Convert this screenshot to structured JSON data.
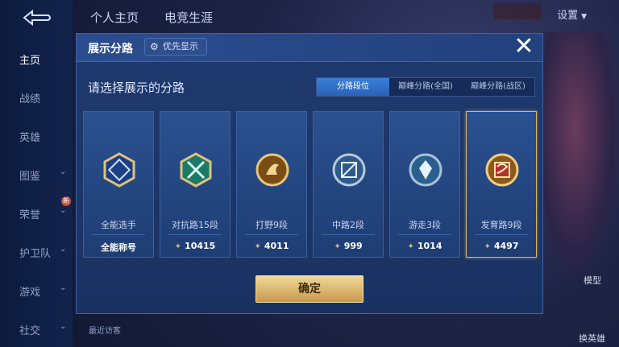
{
  "sidebar": {
    "items": [
      {
        "label": "主页"
      },
      {
        "label": "战绩"
      },
      {
        "label": "英雄"
      },
      {
        "label": "图鉴"
      },
      {
        "label": "荣誉"
      },
      {
        "label": "护卫队"
      },
      {
        "label": "游戏"
      },
      {
        "label": "社交"
      }
    ],
    "badge": "新"
  },
  "topbar": {
    "tabs": [
      {
        "label": "个人主页"
      },
      {
        "label": "电竞生涯"
      }
    ],
    "settings": "设置"
  },
  "background": {
    "recent": "最近访客",
    "model": "模型",
    "hero": "换英雄"
  },
  "modal": {
    "title": "展示分路",
    "priority_button": "优先显示",
    "prompt": "请选择展示的分路",
    "tabs": [
      {
        "label": "分路段位",
        "active": true
      },
      {
        "label": "巅峰分路(全国)",
        "active": false
      },
      {
        "label": "巅峰分路(战区)",
        "active": false
      }
    ],
    "cards": [
      {
        "name": "全能选手",
        "stat": "全能称号",
        "emblem": "all-round-emblem-icon",
        "selected": false
      },
      {
        "name": "对抗路15段",
        "stat": "10415",
        "emblem": "clash-lane-emblem-icon",
        "selected": false
      },
      {
        "name": "打野9段",
        "stat": "4011",
        "emblem": "jungle-emblem-icon",
        "selected": false
      },
      {
        "name": "中路2段",
        "stat": "999",
        "emblem": "mid-lane-emblem-icon",
        "selected": false
      },
      {
        "name": "游走3段",
        "stat": "1014",
        "emblem": "roam-emblem-icon",
        "selected": false
      },
      {
        "name": "发育路9段",
        "stat": "4497",
        "emblem": "farm-lane-emblem-icon",
        "selected": true
      }
    ],
    "confirm": "确定"
  },
  "colors": {
    "accent": "#3a7fd8",
    "gold": "#d9b56a"
  }
}
